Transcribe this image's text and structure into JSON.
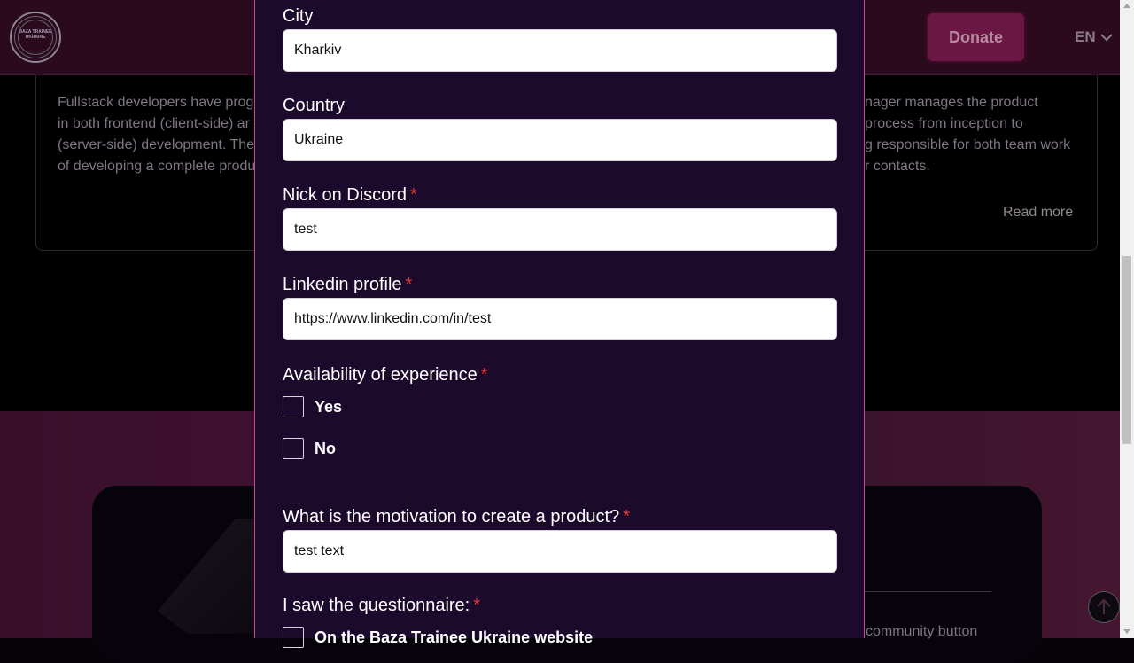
{
  "header": {
    "logo_text": "BAZA TRAINEE UKRAINE",
    "donate_label": "Donate",
    "language": "EN"
  },
  "background": {
    "card_left_lines": [
      "Fullstack developers have prog",
      "in both frontend (client-side) ar",
      "(server-side) development. The",
      "of developing a complete produ"
    ],
    "card_right_lines": [
      "nager manages the product",
      "process from inception to",
      "g responsible for both team work",
      "r contacts."
    ],
    "read_more": "Read more",
    "community_text": "community button"
  },
  "form": {
    "city": {
      "label": "City",
      "value": "Kharkiv"
    },
    "country": {
      "label": "Country",
      "value": "Ukraine"
    },
    "discord": {
      "label": "Nick on Discord",
      "required": "*",
      "value": "test"
    },
    "linkedin": {
      "label": "Linkedin profile",
      "required": "*",
      "value": "https://www.linkedin.com/in/test"
    },
    "experience": {
      "label": "Availability of experience",
      "required": "*",
      "options": [
        "Yes",
        "No"
      ]
    },
    "motivation": {
      "label": "What is the motivation to create a product?",
      "required": "*",
      "value": "test text"
    },
    "questionnaire": {
      "label": "I saw the questionnaire:",
      "required": "*",
      "first_option": "On the Baza Trainee Ukraine website"
    }
  },
  "colors": {
    "modal_bg": "#1c0a2c",
    "modal_border": "#c54a93",
    "required": "#e53935",
    "donate_bg": "#6b1744"
  }
}
